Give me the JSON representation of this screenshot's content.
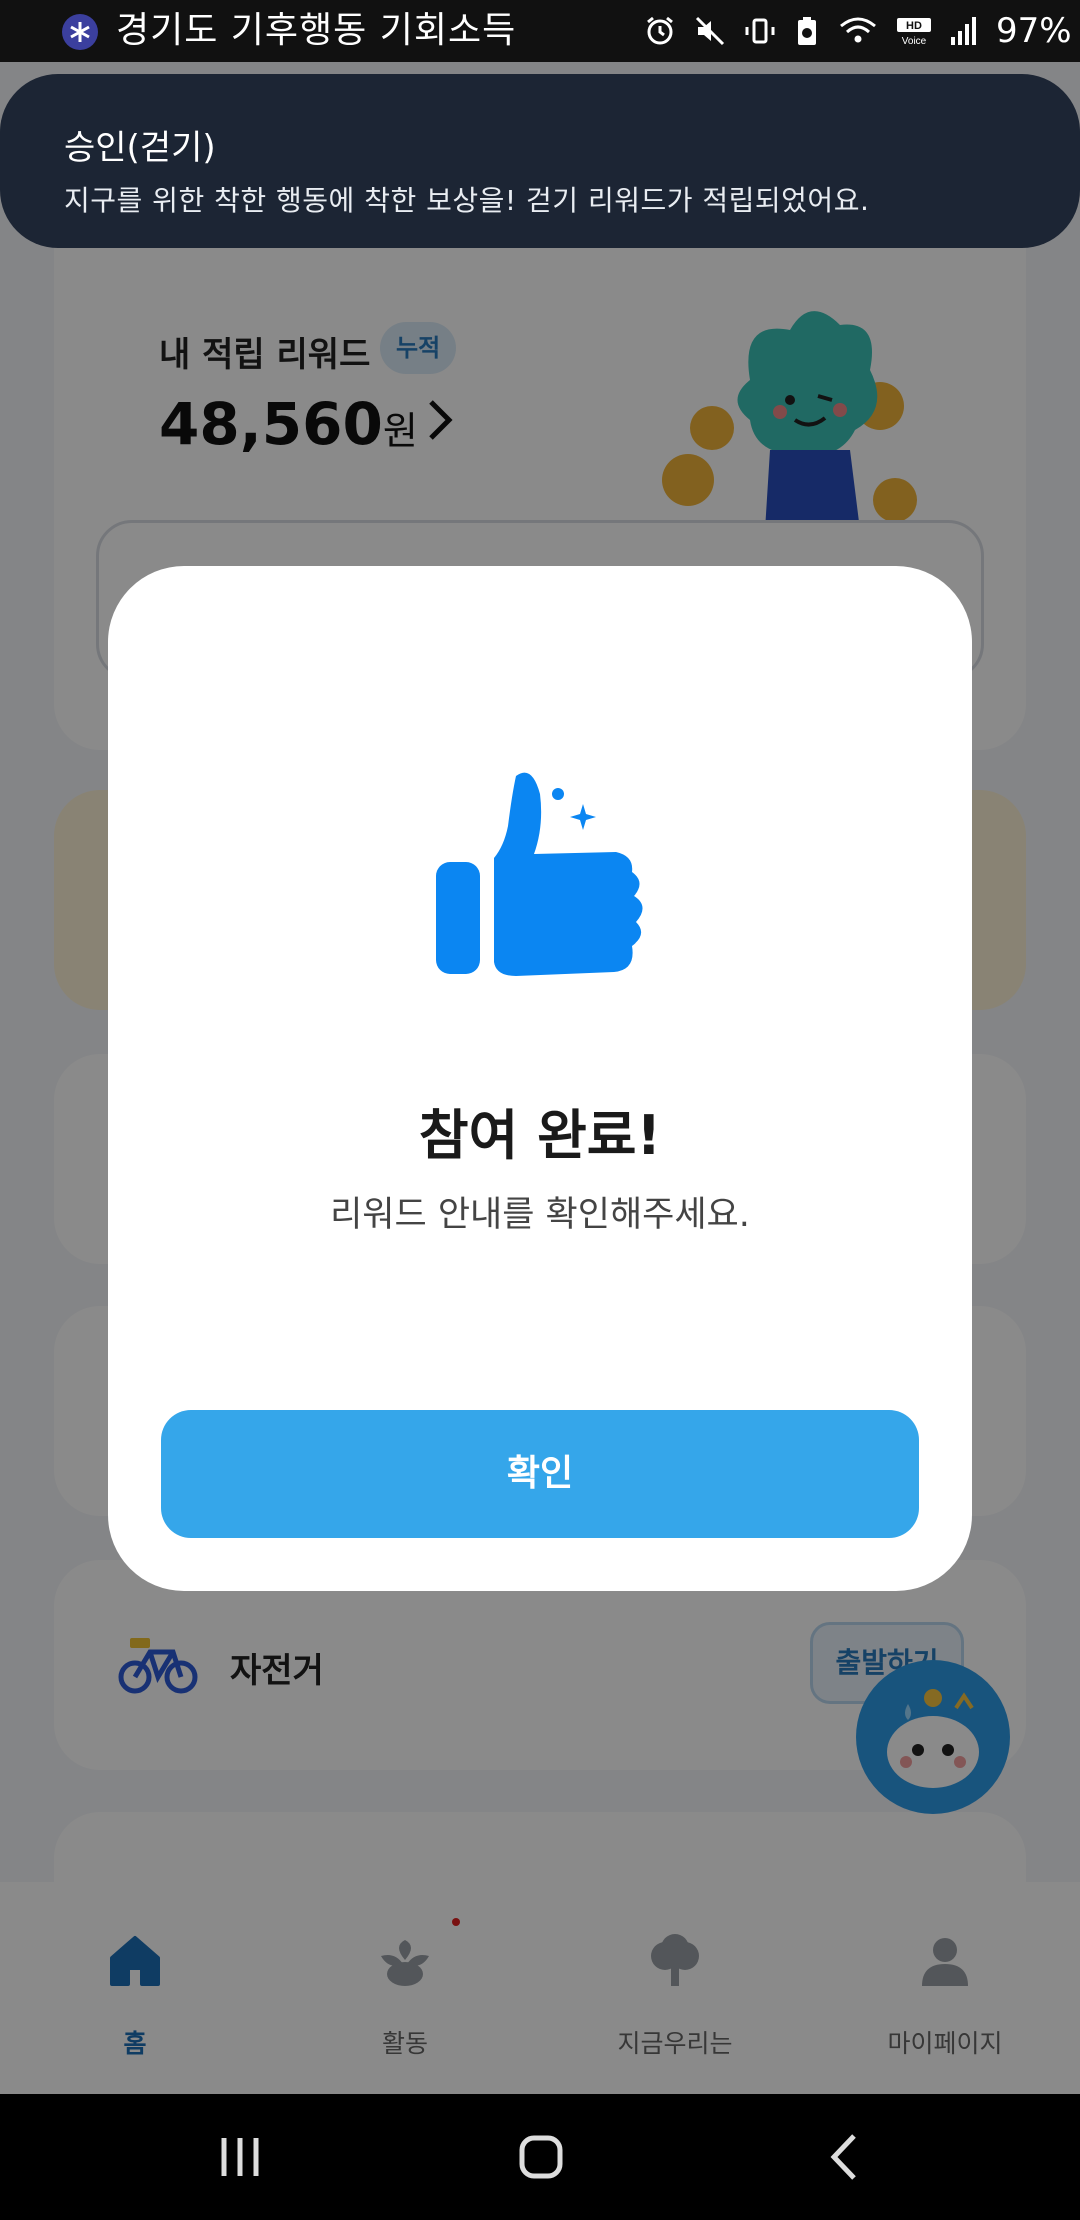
{
  "status_bar": {
    "title": "경기도 기후행동 기회소득",
    "battery": "97%",
    "icons": [
      "alarm-icon",
      "mute-icon",
      "vibrate-icon",
      "battery-saver-icon",
      "wifi-icon",
      "hd-voice-icon",
      "signal-icon",
      "battery-icon"
    ]
  },
  "notification": {
    "title": "승인(걷기)",
    "body": "지구를 위한 착한 행동에 착한 보상을! 걷기 리워드가 적립되었어요."
  },
  "reward": {
    "label": "내 적립 리워드",
    "badge": "누적",
    "amount": "48,560",
    "unit": "원"
  },
  "bike": {
    "label": "자전거",
    "button": "출발하기"
  },
  "bottom_nav": {
    "items": [
      {
        "label": "홈",
        "icon": "home-icon",
        "active": true
      },
      {
        "label": "활동",
        "icon": "sprout-icon",
        "active": false
      },
      {
        "label": "지금우리는",
        "icon": "tree-icon",
        "active": false
      },
      {
        "label": "마이페이지",
        "icon": "person-icon",
        "active": false
      }
    ]
  },
  "modal": {
    "icon": "thumbs-up-icon",
    "title": "참여 완료!",
    "subtitle": "리워드 안내를 확인해주세요.",
    "confirm_label": "확인"
  },
  "colors": {
    "accent": "#35a6ea",
    "thumb": "#0b86f2",
    "notification_bg": "#1c2534"
  }
}
